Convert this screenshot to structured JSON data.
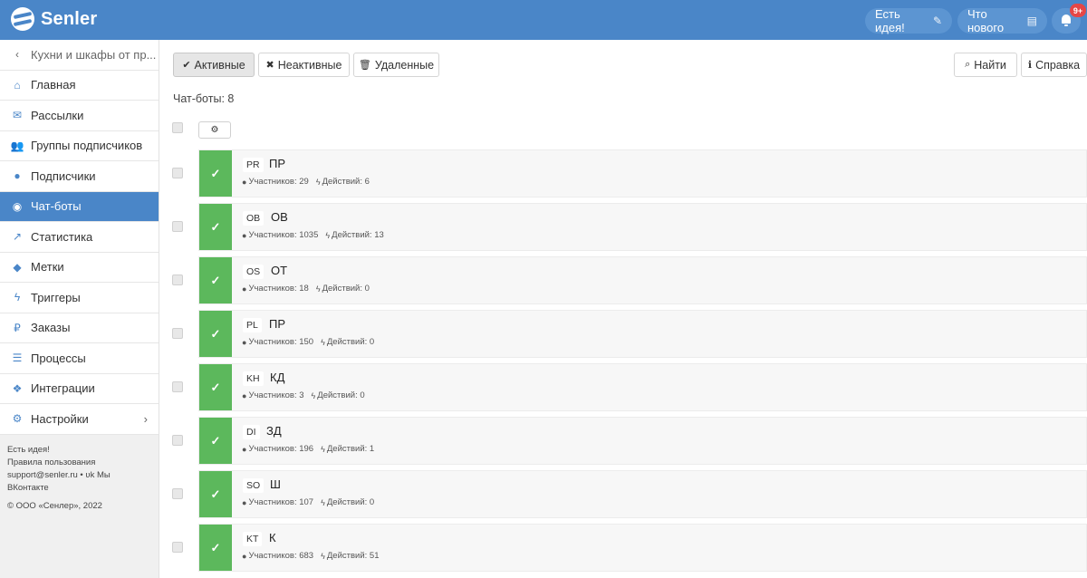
{
  "header": {
    "logo_text": "Senler",
    "idea_label": "Есть идея!",
    "whats_new_label": "Что нового",
    "notif_badge": "9+"
  },
  "sidebar": {
    "back_label": "Кухни и шкафы от пр...",
    "items": [
      {
        "label": "Главная",
        "icon": "home-icon"
      },
      {
        "label": "Рассылки",
        "icon": "envelope-icon"
      },
      {
        "label": "Группы подписчиков",
        "icon": "users-icon"
      },
      {
        "label": "Подписчики",
        "icon": "user-icon"
      },
      {
        "label": "Чат-боты",
        "icon": "android-icon"
      },
      {
        "label": "Статистика",
        "icon": "line-chart-icon"
      },
      {
        "label": "Метки",
        "icon": "tag-icon"
      },
      {
        "label": "Триггеры",
        "icon": "bolt-icon"
      },
      {
        "label": "Заказы",
        "icon": "ruble-icon"
      },
      {
        "label": "Процессы",
        "icon": "tasks-icon"
      },
      {
        "label": "Интеграции",
        "icon": "cubes-icon"
      },
      {
        "label": "Настройки",
        "icon": "cogs-icon"
      }
    ],
    "active_index": 4,
    "footer": {
      "idea": "Есть идея!",
      "terms": "Правила пользования",
      "support": "support@senler.ru",
      "vk": "Мы ВКонтакте",
      "copyright": "© ООО «Сенлер», 2022"
    }
  },
  "toolbar": {
    "active_label": "Активные",
    "inactive_label": "Неактивные",
    "deleted_label": "Удаленные",
    "search_label": "Найти",
    "help_label": "Справка"
  },
  "count_text": "Чат-боты: 8",
  "bots": [
    {
      "abbr": "PR",
      "name": "ПР",
      "members": "Участников: 29",
      "actions": "Действий: 6"
    },
    {
      "abbr": "OB",
      "name": "ОВ",
      "members": "Участников: 1035",
      "actions": "Действий: 13"
    },
    {
      "abbr": "OS",
      "name": "ОТ",
      "members": "Участников: 18",
      "actions": "Действий: 0"
    },
    {
      "abbr": "PL",
      "name": "ПР",
      "members": "Участников: 150",
      "actions": "Действий: 0"
    },
    {
      "abbr": "KH",
      "name": "КД",
      "members": "Участников: 3",
      "actions": "Действий: 0"
    },
    {
      "abbr": "DI",
      "name": "ЗД",
      "members": "Участников: 196",
      "actions": "Действий: 1"
    },
    {
      "abbr": "SO",
      "name": "Ш",
      "members": "Участников: 107",
      "actions": "Действий: 0"
    },
    {
      "abbr": "KT",
      "name": "К",
      "members": "Участников: 683",
      "actions": "Действий: 51"
    }
  ],
  "colors": {
    "brand": "#4a86c8",
    "active_status": "#5cb85c"
  }
}
